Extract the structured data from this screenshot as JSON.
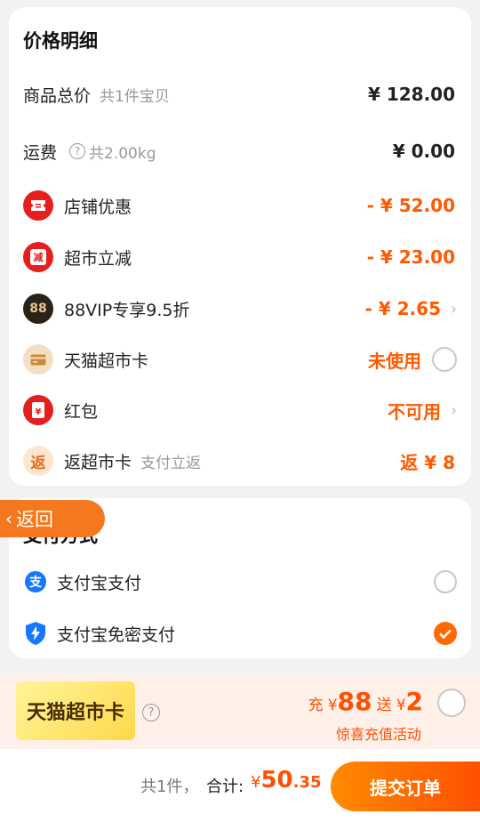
{
  "price_detail": {
    "title": "价格明细",
    "goods_total": {
      "label": "商品总价",
      "sub": "共1件宝贝",
      "amount": "¥ 128.00"
    },
    "shipping": {
      "label": "运费",
      "sub": "共2.00kg",
      "amount": "¥ 0.00",
      "help": "?"
    },
    "items": [
      {
        "name": "store-discount",
        "label": "店铺优惠",
        "amount": "- ¥ 52.00",
        "icon": "ticket-icon"
      },
      {
        "name": "market-reduction",
        "label": "超市立减",
        "amount": "- ¥ 23.00",
        "icon": "reduce-icon",
        "icon_text": "减"
      },
      {
        "name": "vip-discount",
        "label": "88VIP专享9.5折",
        "amount": "- ¥ 2.65",
        "icon": "vip88-icon",
        "icon_text": "88"
      },
      {
        "name": "tmall-card",
        "label": "天猫超市卡",
        "amount": "未使用",
        "icon": "card-icon"
      },
      {
        "name": "red-packet",
        "label": "红包",
        "amount": "不可用",
        "icon": "red-packet-icon",
        "icon_text": "¥"
      },
      {
        "name": "rebate-card",
        "label": "返超市卡",
        "sub": "支付立返",
        "amount": "返 ¥ 8",
        "icon": "rebate-icon",
        "icon_text": "返"
      }
    ]
  },
  "payment": {
    "title": "支付方式",
    "methods": [
      {
        "label": "支付宝支付",
        "selected": false
      },
      {
        "label": "支付宝免密支付",
        "selected": true
      }
    ]
  },
  "back_button": {
    "label": "返回"
  },
  "promo": {
    "card_label": "天猫超市卡",
    "help": "?",
    "charge_prefix": "充",
    "currency": "¥",
    "charge_amount": "88",
    "gift_prefix": "送",
    "gift_amount": "2",
    "subtitle": "惊喜充值活动"
  },
  "footer": {
    "count": "共1件，",
    "total_label": "合计:",
    "currency": "¥",
    "total_int": "50",
    "total_dec": ".35",
    "submit_label": "提交订单"
  },
  "colors": {
    "accent": "#ff5a00",
    "icon_red": "#e61e1e",
    "background": "#f2f2f2"
  }
}
